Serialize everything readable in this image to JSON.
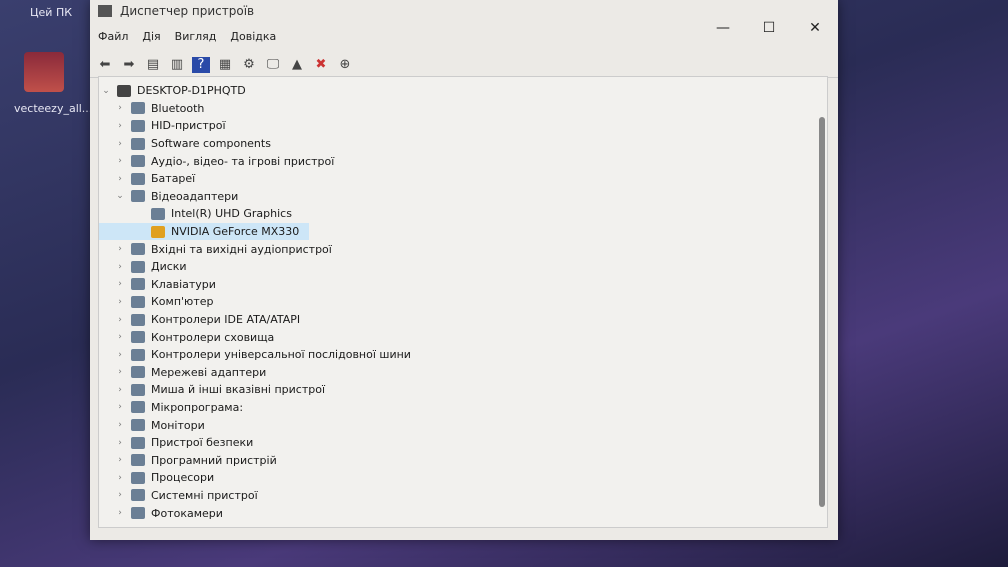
{
  "desktop": {
    "this_pc": "Цей ПК",
    "file_icon_label": "vecteezy_all..."
  },
  "window": {
    "title": "Диспетчер пристроїв",
    "minimize": "—",
    "maximize": "☐",
    "close": "✕"
  },
  "menu": [
    "Файл",
    "Дія",
    "Вигляд",
    "Довідка"
  ],
  "toolbar": [
    "back-icon",
    "forward-icon",
    "properties-icon",
    "update-icon",
    "help-icon",
    "view-icon",
    "scan-icon",
    "monitor-icon",
    "add-driver-icon",
    "uninstall-icon",
    "download-icon"
  ],
  "tree": {
    "root": "DESKTOP-D1PHQTD",
    "items": [
      {
        "label": "Bluetooth",
        "level": 1,
        "expanded": false
      },
      {
        "label": "HID-пристрої",
        "level": 1,
        "expanded": false
      },
      {
        "label": "Software components",
        "level": 1,
        "expanded": false
      },
      {
        "label": "Аудіо-, відео- та ігрові пристрої",
        "level": 1,
        "expanded": false
      },
      {
        "label": "Батареї",
        "level": 1,
        "expanded": false
      },
      {
        "label": "Відеоадаптери",
        "level": 1,
        "expanded": true
      },
      {
        "label": "Intel(R) UHD Graphics",
        "level": 2
      },
      {
        "label": "NVIDIA GeForce MX330",
        "level": 2,
        "selected": true,
        "warning": true
      },
      {
        "label": "Вхідні та вихідні аудіопристрої",
        "level": 1,
        "expanded": false
      },
      {
        "label": "Диски",
        "level": 1,
        "expanded": false
      },
      {
        "label": "Клавіатури",
        "level": 1,
        "expanded": false
      },
      {
        "label": "Комп'ютер",
        "level": 1,
        "expanded": false
      },
      {
        "label": "Контролери IDE ATA/ATAPI",
        "level": 1,
        "expanded": false
      },
      {
        "label": "Контролери сховища",
        "level": 1,
        "expanded": false
      },
      {
        "label": "Контролери універсальної послідовної шини",
        "level": 1,
        "expanded": false
      },
      {
        "label": "Мережеві адаптери",
        "level": 1,
        "expanded": false
      },
      {
        "label": "Миша й інші вказівні пристрої",
        "level": 1,
        "expanded": false
      },
      {
        "label": "Мікропрограма:",
        "level": 1,
        "expanded": false
      },
      {
        "label": "Монітори",
        "level": 1,
        "expanded": false
      },
      {
        "label": "Пристрої безпеки",
        "level": 1,
        "expanded": false
      },
      {
        "label": "Програмний пристрій",
        "level": 1,
        "expanded": false
      },
      {
        "label": "Процесори",
        "level": 1,
        "expanded": false
      },
      {
        "label": "Системні пристрої",
        "level": 1,
        "expanded": false
      },
      {
        "label": "Фотокамери",
        "level": 1,
        "expanded": false
      }
    ]
  }
}
